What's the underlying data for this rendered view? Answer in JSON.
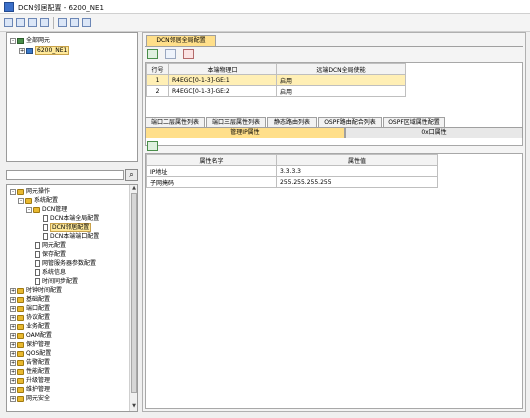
{
  "window": {
    "title": "DCN邻居配置 - 6200_NE1"
  },
  "top_tree": {
    "root_label": "全部网元",
    "ne_label": "6200_NE1"
  },
  "search_icon_label": "⌕",
  "nav_tree": [
    {
      "label": "网元操作",
      "indent": 0,
      "type": "folder",
      "expander": "-"
    },
    {
      "label": "系统配置",
      "indent": 1,
      "type": "folder",
      "expander": "-"
    },
    {
      "label": "DCN管理",
      "indent": 2,
      "type": "folder",
      "expander": "-"
    },
    {
      "label": "DCN本端全局配置",
      "indent": 3,
      "type": "doc"
    },
    {
      "label": "DCN邻居配置",
      "indent": 3,
      "type": "doc",
      "selected": true
    },
    {
      "label": "DCN本端端口配置",
      "indent": 3,
      "type": "doc"
    },
    {
      "label": "网元配置",
      "indent": 2,
      "type": "doc"
    },
    {
      "label": "保存配置",
      "indent": 2,
      "type": "doc"
    },
    {
      "label": "网管服务器参数配置",
      "indent": 2,
      "type": "doc"
    },
    {
      "label": "系统信息",
      "indent": 2,
      "type": "doc"
    },
    {
      "label": "时间同步配置",
      "indent": 2,
      "type": "doc"
    },
    {
      "label": "时钟时间配置",
      "indent": 0,
      "type": "folder",
      "expander": "+"
    },
    {
      "label": "基础配置",
      "indent": 0,
      "type": "folder",
      "expander": "+"
    },
    {
      "label": "端口配置",
      "indent": 0,
      "type": "folder",
      "expander": "+"
    },
    {
      "label": "协议配置",
      "indent": 0,
      "type": "folder",
      "expander": "+"
    },
    {
      "label": "业务配置",
      "indent": 0,
      "type": "folder",
      "expander": "+"
    },
    {
      "label": "OAM配置",
      "indent": 0,
      "type": "folder",
      "expander": "+"
    },
    {
      "label": "保护管理",
      "indent": 0,
      "type": "folder",
      "expander": "+"
    },
    {
      "label": "QOS配置",
      "indent": 0,
      "type": "folder",
      "expander": "+"
    },
    {
      "label": "告警配置",
      "indent": 0,
      "type": "folder",
      "expander": "+"
    },
    {
      "label": "性能配置",
      "indent": 0,
      "type": "folder",
      "expander": "+"
    },
    {
      "label": "升级管理",
      "indent": 0,
      "type": "folder",
      "expander": "+"
    },
    {
      "label": "维护管理",
      "indent": 0,
      "type": "folder",
      "expander": "+"
    },
    {
      "label": "网元安全",
      "indent": 0,
      "type": "folder",
      "expander": "+"
    }
  ],
  "main_tab": {
    "label": "DCN邻居全局配置"
  },
  "neighbor_table": {
    "columns": [
      "行号",
      "本端物理口",
      "远端DCN全局使能"
    ],
    "rows": [
      [
        "1",
        "R4EGC[0-1-3]-GE:1",
        "启用"
      ],
      [
        "2",
        "R4EGC[0-1-3]-GE:2",
        "启用"
      ]
    ]
  },
  "sub_tabs": [
    "端口二层属性列表",
    "端口三层属性列表",
    "静态路由列表",
    "OSPF路由配合列表",
    "OSPF区域属性配置"
  ],
  "sub_tabs2": [
    "管理IP属性",
    "0x口属性"
  ],
  "attr_table": {
    "columns": [
      "属性名字",
      "属性值"
    ],
    "rows": [
      [
        "IP地址",
        "3.3.3.3"
      ],
      [
        "子网掩码",
        "255.255.255.255"
      ]
    ]
  },
  "colors": {
    "selected_tab": "#ffdf8a",
    "selected_row": "#ffefb5",
    "tree_selection": "#ffe99a"
  }
}
